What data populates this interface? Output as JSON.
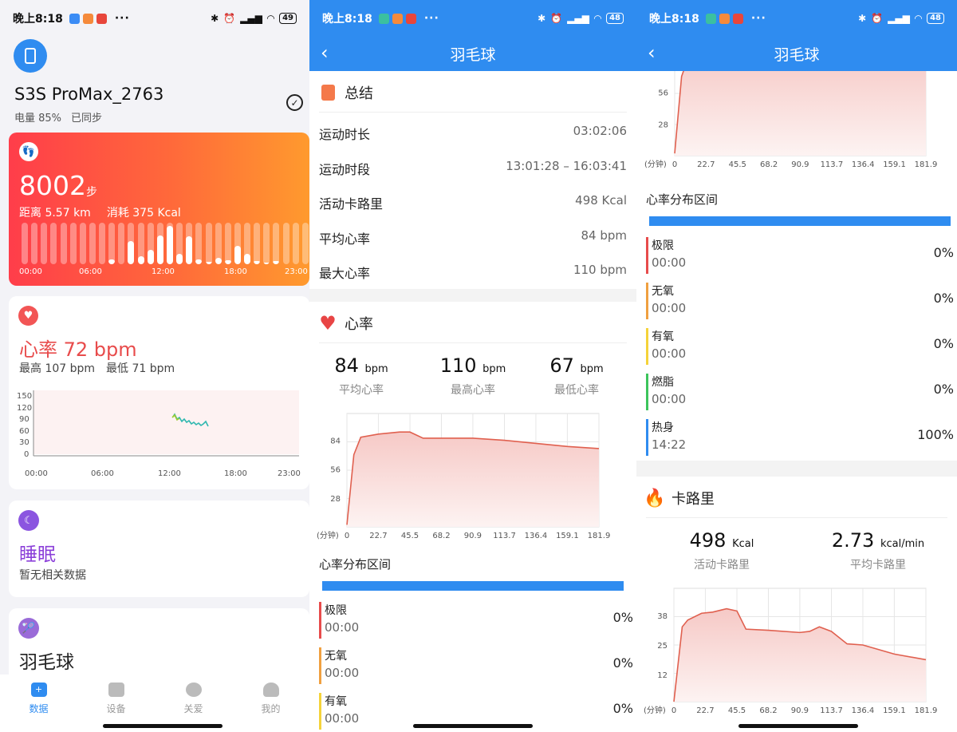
{
  "status": {
    "time": "晚上8:18",
    "dots": "···",
    "battery1": "49",
    "battery2": "48",
    "battery3": "48"
  },
  "device": {
    "name": "S3S ProMax_2763",
    "battery": "电量 85%",
    "sync": "已同步"
  },
  "steps": {
    "count": "8002",
    "unit": "步",
    "distance": "距离 5.57 km",
    "calories": "消耗 375 Kcal",
    "hourly": [
      0,
      0,
      0,
      0,
      0,
      0,
      0,
      0,
      0,
      0.12,
      0,
      0.55,
      0.2,
      0.35,
      0.7,
      0.92,
      0.25,
      0.68,
      0.12,
      0.05,
      0.15,
      0.1,
      0.45,
      0.25,
      0.08,
      0.04,
      0.08,
      0,
      0,
      0
    ],
    "time_labels": [
      "00:00",
      "06:00",
      "12:00",
      "18:00",
      "23:00"
    ]
  },
  "heart": {
    "title": "心率 72 bpm",
    "max": "最高 107 bpm",
    "min": "最低 71 bpm",
    "y_ticks": [
      "150",
      "120",
      "90",
      "60",
      "30",
      "0"
    ],
    "x_labels": [
      "00:00",
      "06:00",
      "12:00",
      "18:00",
      "23:00"
    ]
  },
  "sleep": {
    "title": "睡眠",
    "sub": "暂无相关数据"
  },
  "badminton": {
    "title": "羽毛球"
  },
  "tabs": [
    {
      "label": "数据",
      "active": true
    },
    {
      "label": "设备"
    },
    {
      "label": "关爱"
    },
    {
      "label": "我的"
    }
  ],
  "detail": {
    "title": "羽毛球",
    "summary_title": "总结",
    "summary": [
      {
        "k": "运动时长",
        "v": "03:02:06"
      },
      {
        "k": "运动时段",
        "v": "13:01:28 – 16:03:41"
      },
      {
        "k": "活动卡路里",
        "v": "498 Kcal"
      },
      {
        "k": "平均心率",
        "v": "84 bpm"
      },
      {
        "k": "最大心率",
        "v": "110 bpm"
      }
    ],
    "hr_title": "心率",
    "hr_stats": [
      {
        "n": "84",
        "u": "bpm",
        "l": "平均心率"
      },
      {
        "n": "110",
        "u": "bpm",
        "l": "最高心率"
      },
      {
        "n": "67",
        "u": "bpm",
        "l": "最低心率"
      }
    ],
    "zone_title": "心率分布区间",
    "zones": [
      {
        "name": "极限",
        "time": "00:00",
        "pct": "0%",
        "color": "#e74c4c"
      },
      {
        "name": "无氧",
        "time": "00:00",
        "pct": "0%",
        "color": "#f0a040"
      },
      {
        "name": "有氧",
        "time": "00:00",
        "pct": "0%",
        "color": "#f5d33a"
      },
      {
        "name": "燃脂",
        "time": "00:00",
        "pct": "0%",
        "color": "#3cc45c"
      },
      {
        "name": "热身",
        "time": "14:22",
        "pct": "100%",
        "color": "#2f8cf0"
      }
    ],
    "cal_title": "卡路里",
    "cal_stats": [
      {
        "n": "498",
        "u": "Kcal",
        "l": "活动卡路里"
      },
      {
        "n": "2.73",
        "u": "kcal/min",
        "l": "平均卡路里"
      }
    ]
  },
  "chart_data": [
    {
      "type": "line",
      "name": "hr_detail",
      "x_prefix": "(分钟)",
      "x": [
        0,
        22.7,
        45.5,
        68.2,
        90.9,
        113.7,
        136.4,
        159.1,
        181.9
      ],
      "yticks": [
        84,
        56,
        28
      ],
      "ylim": [
        0,
        110
      ],
      "points": [
        [
          0,
          2
        ],
        [
          5,
          70
        ],
        [
          10,
          87
        ],
        [
          22.7,
          90
        ],
        [
          38,
          92
        ],
        [
          45.5,
          92
        ],
        [
          55,
          86
        ],
        [
          68.2,
          86
        ],
        [
          90.9,
          86
        ],
        [
          113.7,
          84
        ],
        [
          136.4,
          81
        ],
        [
          159.1,
          78
        ],
        [
          181.9,
          76
        ]
      ]
    },
    {
      "type": "line",
      "name": "calorie_detail",
      "x_prefix": "(分钟)",
      "x": [
        0,
        22.7,
        45.5,
        68.2,
        90.9,
        113.7,
        136.4,
        159.1,
        181.9
      ],
      "yticks": [
        38,
        25,
        12
      ],
      "ylim": [
        0,
        50
      ],
      "points": [
        [
          0,
          0
        ],
        [
          6,
          33
        ],
        [
          10,
          36
        ],
        [
          20,
          39
        ],
        [
          28,
          39.5
        ],
        [
          38,
          41
        ],
        [
          45.5,
          40
        ],
        [
          52,
          32
        ],
        [
          68.2,
          31.5
        ],
        [
          90.9,
          30.5
        ],
        [
          98,
          31
        ],
        [
          105,
          33
        ],
        [
          113.7,
          31
        ],
        [
          125,
          25.5
        ],
        [
          136.4,
          25
        ],
        [
          159.1,
          21
        ],
        [
          181.9,
          18.5
        ]
      ]
    }
  ]
}
